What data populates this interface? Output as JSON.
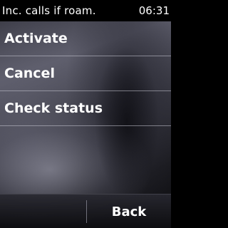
{
  "status_bar": {
    "title": "Inc. calls if roam.",
    "time": "06:31"
  },
  "menu": {
    "items": [
      {
        "label": "Activate"
      },
      {
        "label": "Cancel"
      },
      {
        "label": "Check status"
      }
    ]
  },
  "softkeys": {
    "left_label": "",
    "right_label": "Back"
  }
}
